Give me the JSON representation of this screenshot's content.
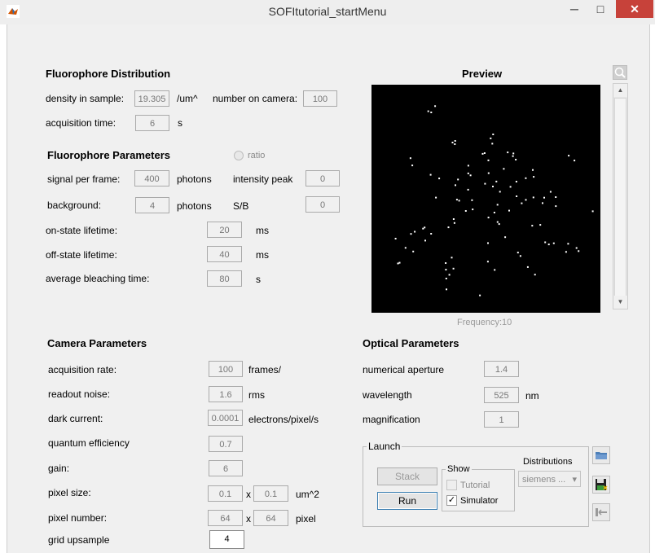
{
  "window": {
    "title": "SOFItutorial_startMenu",
    "min_glyph": "─",
    "max_glyph": "□",
    "close_glyph": "✕"
  },
  "fluorophore_distribution": {
    "heading": "Fluorophore Distribution",
    "density_label": "density in sample:",
    "density_value": "19.305",
    "density_unit": "/um^",
    "number_label": "number on camera:",
    "number_value": "100",
    "acq_label": "acquisition time:",
    "acq_value": "6",
    "acq_unit": "s"
  },
  "fluorophore_parameters": {
    "heading": "Fluorophore Parameters",
    "ratio_label": "ratio",
    "signal_label": "signal per frame:",
    "signal_value": "400",
    "signal_unit": "photons",
    "intensity_label": "intensity peak",
    "intensity_value": "0",
    "background_label": "background:",
    "background_value": "4",
    "background_unit": "photons",
    "sb_label": "S/B",
    "sb_value": "0",
    "on_label": "on-state lifetime:",
    "on_value": "20",
    "on_unit": "ms",
    "off_label": "off-state lifetime:",
    "off_value": "40",
    "off_unit": "ms",
    "bleach_label": "average bleaching time:",
    "bleach_value": "80",
    "bleach_unit": "s"
  },
  "preview": {
    "heading": "Preview",
    "frequency": "Frequency:10"
  },
  "camera_parameters": {
    "heading": "Camera Parameters",
    "rate_label": "acquisition rate:",
    "rate_value": "100",
    "rate_unit": "frames/",
    "noise_label": "readout noise:",
    "noise_value": "1.6",
    "noise_unit": "rms",
    "dark_label": "dark current:",
    "dark_value": "0.0001",
    "dark_unit": "electrons/pixel/s",
    "qe_label": "quantum efficiency",
    "qe_value": "0.7",
    "gain_label": "gain:",
    "gain_value": "6",
    "pixsize_label": "pixel size:",
    "pixsize_x": "0.1",
    "pixsize_times": "x",
    "pixsize_y": "0.1",
    "pixsize_unit": "um^2",
    "pixnum_label": "pixel number:",
    "pixnum_x": "64",
    "pixnum_times": "x",
    "pixnum_y": "64",
    "pixnum_unit": "pixel",
    "grid_label": "grid upsample",
    "grid_value": "4"
  },
  "optical_parameters": {
    "heading": "Optical Parameters",
    "na_label": "numerical aperture",
    "na_value": "1.4",
    "wl_label": "wavelength",
    "wl_value": "525",
    "wl_unit": "nm",
    "mag_label": "magnification",
    "mag_value": "1"
  },
  "launch": {
    "heading": "Launch",
    "stack_label": "Stack",
    "run_label": "Run",
    "show_heading": "Show",
    "tutorial_label": "Tutorial",
    "simulator_label": "Simulator",
    "simulator_check": "✓",
    "distributions_heading": "Distributions",
    "distribution_value": "siemens ...",
    "dropdown_glyph": "▾"
  },
  "scrollbar": {
    "up_glyph": "▲",
    "down_glyph": "▼"
  },
  "colors": {
    "close": "#c7423a",
    "preview_bg": "#000000",
    "panel": "#f0f0f0"
  }
}
